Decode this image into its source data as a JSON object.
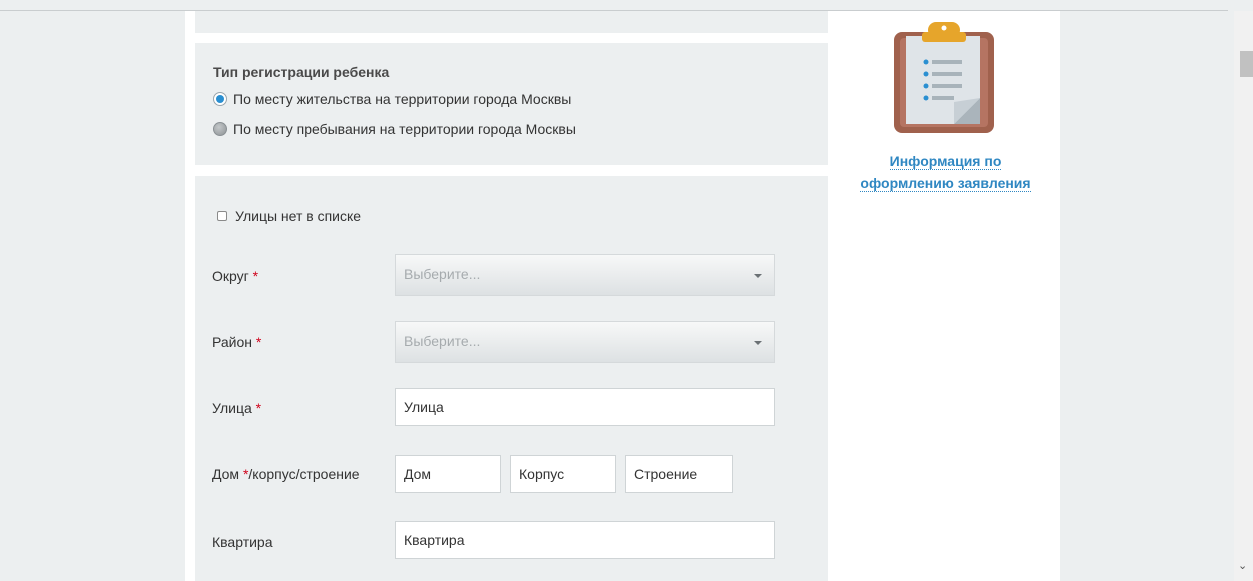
{
  "registration": {
    "title": "Тип регистрации ребенка",
    "options": [
      {
        "label": "По месту жительства на территории города Москвы",
        "selected": true
      },
      {
        "label": "По месту пребывания на территории города Москвы",
        "selected": false
      }
    ]
  },
  "address": {
    "no_street_label": "Улицы нет в списке",
    "required_mark": "*",
    "okrug": {
      "label": "Округ",
      "placeholder": "Выберите..."
    },
    "rayon": {
      "label": "Район",
      "placeholder": "Выберите..."
    },
    "street": {
      "label": "Улица",
      "placeholder": "Улица"
    },
    "house": {
      "label_prefix": "Дом ",
      "label_suffix": "/корпус/строение",
      "house_placeholder": "Дом",
      "korpus_placeholder": "Корпус",
      "stroenie_placeholder": "Строение"
    },
    "apartment": {
      "label": "Квартира",
      "placeholder": "Квартира"
    }
  },
  "sidebar": {
    "info_icon": "clipboard-list-icon",
    "info_link_line1": "Информация по",
    "info_link_line2": "оформлению заявления"
  },
  "colors": {
    "accent": "#2a8fd1",
    "link": "#2f87c2",
    "required": "#d0021b",
    "panel_bg": "#eceff0"
  }
}
